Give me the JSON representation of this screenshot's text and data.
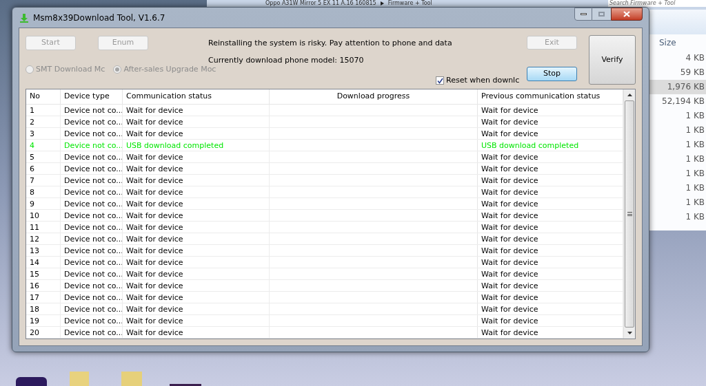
{
  "window": {
    "title": "Msm8x39Download Tool, V1.6.7"
  },
  "buttons": [
    {
      "label": "Start",
      "disabled": true
    },
    {
      "label": "Enum",
      "disabled": true
    }
  ],
  "notice": "Reinstalling the system is risky. Pay attention to phone and data",
  "model_line": "Currently download phone model: 15070",
  "exit_button": {
    "label": "Exit",
    "disabled": true
  },
  "verify_button": {
    "label": "Verify"
  },
  "stop_button": {
    "label": "Stop",
    "focused": true
  },
  "modes": [
    {
      "label": "SMT Download Mc",
      "selected": false
    },
    {
      "label": "After-sales Upgrade Moc",
      "selected": true
    }
  ],
  "reset_checkbox": {
    "label": "Reset when downlc",
    "checked": true
  },
  "table": {
    "columns": [
      "No",
      "Device type",
      "Communication status",
      "Download progress",
      "Previous communication status"
    ],
    "rows": [
      {
        "no": "1",
        "device": "Device not co...",
        "status": "Wait for device",
        "previous": "Wait for device",
        "color": "#000000"
      },
      {
        "no": "2",
        "device": "Device not co...",
        "status": "Wait for device",
        "previous": "Wait for device",
        "color": "#000000"
      },
      {
        "no": "3",
        "device": "Device not co...",
        "status": "Wait for device",
        "previous": "Wait for device",
        "color": "#000000"
      },
      {
        "no": "4",
        "device": "Device not co...",
        "status": "USB download completed",
        "previous": "USB download completed",
        "color": "#00e600"
      },
      {
        "no": "5",
        "device": "Device not co...",
        "status": "Wait for device",
        "previous": "Wait for device",
        "color": "#000000"
      },
      {
        "no": "6",
        "device": "Device not co...",
        "status": "Wait for device",
        "previous": "Wait for device",
        "color": "#000000"
      },
      {
        "no": "7",
        "device": "Device not co...",
        "status": "Wait for device",
        "previous": "Wait for device",
        "color": "#000000"
      },
      {
        "no": "8",
        "device": "Device not co...",
        "status": "Wait for device",
        "previous": "Wait for device",
        "color": "#000000"
      },
      {
        "no": "9",
        "device": "Device not co...",
        "status": "Wait for device",
        "previous": "Wait for device",
        "color": "#000000"
      },
      {
        "no": "10",
        "device": "Device not co...",
        "status": "Wait for device",
        "previous": "Wait for device",
        "color": "#000000"
      },
      {
        "no": "11",
        "device": "Device not co...",
        "status": "Wait for device",
        "previous": "Wait for device",
        "color": "#000000"
      },
      {
        "no": "12",
        "device": "Device not co...",
        "status": "Wait for device",
        "previous": "Wait for device",
        "color": "#000000"
      },
      {
        "no": "13",
        "device": "Device not co...",
        "status": "Wait for device",
        "previous": "Wait for device",
        "color": "#000000"
      },
      {
        "no": "14",
        "device": "Device not co...",
        "status": "Wait for device",
        "previous": "Wait for device",
        "color": "#000000"
      },
      {
        "no": "15",
        "device": "Device not co...",
        "status": "Wait for device",
        "previous": "Wait for device",
        "color": "#000000"
      },
      {
        "no": "16",
        "device": "Device not co...",
        "status": "Wait for device",
        "previous": "Wait for device",
        "color": "#000000"
      },
      {
        "no": "17",
        "device": "Device not co...",
        "status": "Wait for device",
        "previous": "Wait for device",
        "color": "#000000"
      },
      {
        "no": "18",
        "device": "Device not co...",
        "status": "Wait for device",
        "previous": "Wait for device",
        "color": "#000000"
      },
      {
        "no": "19",
        "device": "Device not co...",
        "status": "Wait for device",
        "previous": "Wait for device",
        "color": "#000000"
      },
      {
        "no": "20",
        "device": "Device not co...",
        "status": "Wait for device",
        "previous": "Wait for device",
        "color": "#000000"
      }
    ]
  },
  "explorer": {
    "breadcrumb": [
      "Oppo A31W Mirror 5 EX 11 A.16 160815",
      "Firmware + Tool"
    ],
    "search_placeholder": "Search Firmware + Tool",
    "size_header": "Size",
    "sizes": [
      {
        "value": "4 KB",
        "selected": false
      },
      {
        "value": "59 KB",
        "selected": false
      },
      {
        "value": "1,976 KB",
        "selected": true
      },
      {
        "value": "52,194 KB",
        "selected": false
      },
      {
        "value": "1 KB",
        "selected": false
      },
      {
        "value": "1 KB",
        "selected": false
      },
      {
        "value": "1 KB",
        "selected": false
      },
      {
        "value": "1 KB",
        "selected": false
      },
      {
        "value": "1 KB",
        "selected": false
      },
      {
        "value": "1 KB",
        "selected": false
      },
      {
        "value": "1 KB",
        "selected": false
      },
      {
        "value": "1 KB",
        "selected": false
      }
    ]
  }
}
